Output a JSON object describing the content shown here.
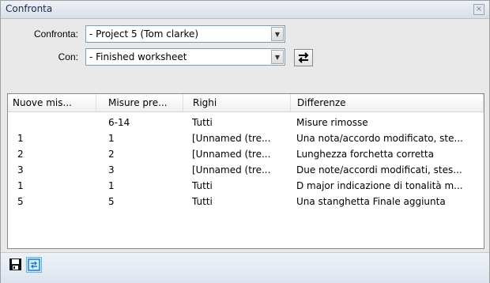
{
  "window": {
    "title": "Confronta"
  },
  "form": {
    "compare_label": "Confronta:",
    "compare_value": "- Project 5 (Tom clarke)",
    "with_label": "Con:",
    "with_value": "- Finished worksheet"
  },
  "table": {
    "columns": [
      "Nuove mis...",
      "Misure pre...",
      "Righi",
      "Differenze"
    ],
    "rows": [
      [
        "",
        "6-14",
        "Tutti",
        "Misure rimosse"
      ],
      [
        "1",
        "1",
        "[Unnamed (tre...",
        "Una nota/accordo modificato, ste..."
      ],
      [
        "2",
        "2",
        "[Unnamed (tre...",
        "Lunghezza forchetta corretta"
      ],
      [
        "3",
        "3",
        "[Unnamed (tre...",
        "Due note/accordi modificati, stes..."
      ],
      [
        "1",
        "1",
        "Tutti",
        "D major indicazione di tonalità m..."
      ],
      [
        "5",
        "5",
        "Tutti",
        "Una stanghetta Finale aggiunta"
      ]
    ]
  },
  "icons": {
    "close": "close-icon",
    "swap": "swap-arrows-icon",
    "save": "save-icon",
    "compare": "compare-icon"
  }
}
